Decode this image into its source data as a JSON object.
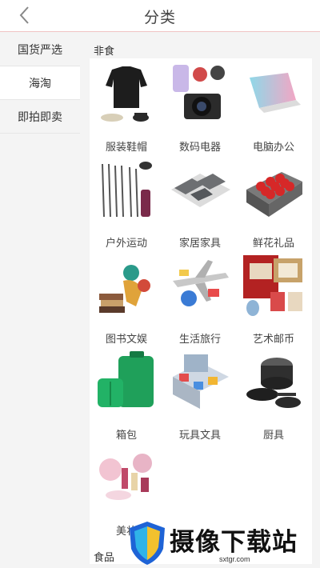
{
  "header": {
    "title": "分类"
  },
  "sidebar": {
    "items": [
      {
        "label": "国货严选"
      },
      {
        "label": "海淘"
      },
      {
        "label": "即拍即卖"
      }
    ]
  },
  "sections": [
    {
      "title": "非食",
      "items": [
        {
          "label": "服装鞋帽",
          "icon": "clothing-icon"
        },
        {
          "label": "数码电器",
          "icon": "electronics-icon"
        },
        {
          "label": "电脑办公",
          "icon": "laptop-icon"
        },
        {
          "label": "户外运动",
          "icon": "sports-icon"
        },
        {
          "label": "家居家具",
          "icon": "furniture-icon"
        },
        {
          "label": "鲜花礼品",
          "icon": "flowers-icon"
        },
        {
          "label": "图书文娱",
          "icon": "books-icon"
        },
        {
          "label": "生活旅行",
          "icon": "travel-icon"
        },
        {
          "label": "艺术邮币",
          "icon": "stamps-icon"
        },
        {
          "label": "箱包",
          "icon": "luggage-icon"
        },
        {
          "label": "玩具文具",
          "icon": "toys-icon"
        },
        {
          "label": "厨具",
          "icon": "cookware-icon"
        },
        {
          "label": "美妆",
          "icon": "cosmetics-icon"
        }
      ]
    },
    {
      "title": "食品",
      "items": []
    }
  ],
  "watermark": {
    "text": "摄像下载站",
    "url": "sxtgr.com"
  }
}
